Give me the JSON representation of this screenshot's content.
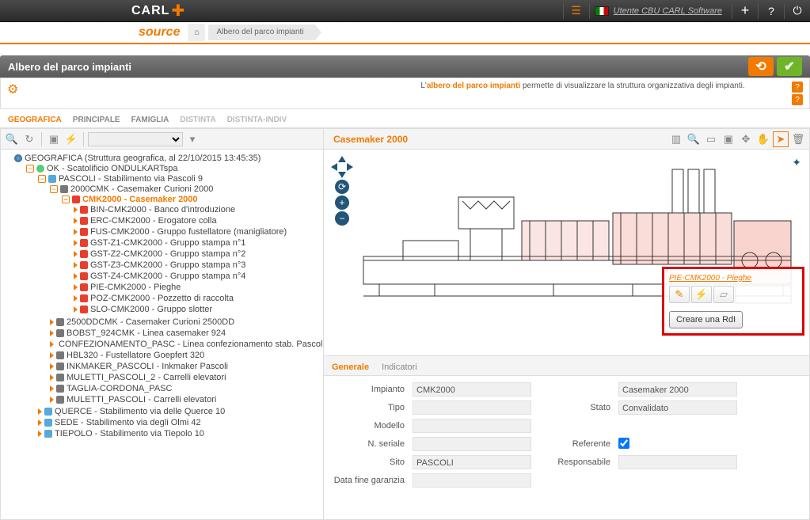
{
  "header": {
    "logo1": "CARL",
    "logo2": "source",
    "user": "Utente CBU CARL Software"
  },
  "breadcrumb": {
    "tab": "Albero del parco impianti"
  },
  "pageTitle": "Albero del parco impianti",
  "infoText": {
    "prefix": "L'",
    "highlight": "albero del parco impianti",
    "suffix": " permette di visualizzare la struttura organizzativa degli impianti."
  },
  "viewTabs": {
    "t0": "GEOGRAFICA",
    "t1": "PRINCIPALE",
    "t2": "FAMIGLIA",
    "t3": "DISTINTA",
    "t4": "DISTINTA-INDIV"
  },
  "tree": {
    "root": "GEOGRAFICA (Struttura geografica, al 22/10/2015 13:45:35)",
    "n1": "OK - Scatolificio ONDULKARTspa",
    "n2": "PASCOLI - Stabilimento via Pascoli 9",
    "n3": "2000CMK - Casemaker Curioni 2000",
    "n4": "CMK2000 - Casemaker 2000",
    "c0": "BIN-CMK2000 - Banco d'introduzione",
    "c1": "ERC-CMK2000 - Erogatore colla",
    "c2": "FUS-CMK2000 - Gruppo fustellatore (manigliatore)",
    "c3": "GST-Z1-CMK2000 - Gruppo stampa n°1",
    "c4": "GST-Z2-CMK2000 - Gruppo stampa n°2",
    "c5": "GST-Z3-CMK2000 - Gruppo stampa n°3",
    "c6": "GST-Z4-CMK2000 - Gruppo stampa n°4",
    "c7": "PIE-CMK2000 - Pieghe",
    "c8": "POZ-CMK2000 - Pozzetto di raccolta",
    "c9": "SLO-CMK2000 - Gruppo slotter",
    "s0": "2500DDCMK - Casemaker Curioni 2500DD",
    "s1": "BOBST_924CMK - Linea casemaker 924",
    "s2": "CONFEZIONAMENTO_PASC - Linea confezionamento stab. Pascoli",
    "s3": "HBL320 - Fustellatore Goepfert 320",
    "s4": "INKMAKER_PASCOLI - Inkmaker Pascoli",
    "s5": "MULETTI_PASCOLI_2 - Carrelli elevatori",
    "s6": "TAGLIA-CORDONA_PASC",
    "s7": "MULETTI_PASCOLI - Carrelli elevatori",
    "o0": "QUERCE - Stabilimento via delle Querce 10",
    "o1": "SEDE - Stabilimento via degli Olmi 42",
    "o2": "TIEPOLO - Stabilimento via Tiepolo 10"
  },
  "rightTitle": "Casemaker 2000",
  "callout": {
    "title": "PIE-CMK2000 - Pieghe",
    "action": "Creare una RdI"
  },
  "detailTabs": {
    "t0": "Generale",
    "t1": "Indicatori"
  },
  "form": {
    "lbl_impianto": "Impianto",
    "val_impianto": "CMK2000",
    "val_impianto_desc": "Casemaker 2000",
    "lbl_tipo": "Tipo",
    "lbl_stato": "Stato",
    "val_stato": "Convalidato",
    "lbl_modello": "Modello",
    "lbl_nseriale": "N. seriale",
    "lbl_referente": "Referente",
    "lbl_sito": "Sito",
    "val_sito": "PASCOLI",
    "lbl_responsabile": "Responsabile",
    "lbl_dfg": "Data fine garanzia"
  }
}
